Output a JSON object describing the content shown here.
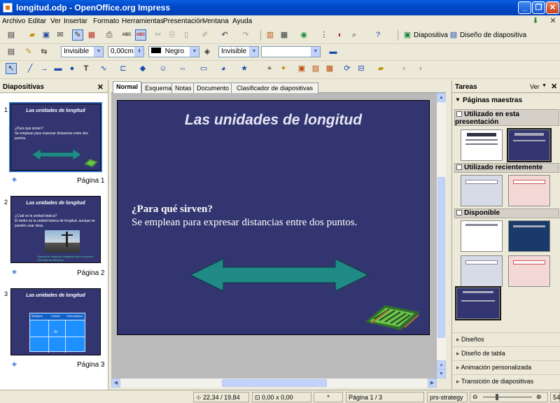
{
  "window": {
    "title": "longitud.odp - OpenOffice.org Impress",
    "buttons": [
      "_",
      "❐",
      "✕"
    ]
  },
  "menu": [
    "Archivo",
    "Editar",
    "Ver",
    "Insertar",
    "Formato",
    "Herramientas",
    "Presentación",
    "Ventana",
    "Ayuda"
  ],
  "toolbar1": {
    "diapositiva_label": "Diapositiva",
    "diseno_label": "Diseño de diapositiva"
  },
  "toolbar2": {
    "line_style": "Invisible",
    "line_width": "0,00cm",
    "line_color": "Negro",
    "area_style": "Invisible",
    "area_value": ""
  },
  "slides_panel": {
    "title": "Diapositivas",
    "slides": [
      {
        "num": "1",
        "title": "Las unidades de longitud",
        "text": "¿Para qué sirven?\nSe emplean para expresar distancias entre dos puntos.",
        "page": "Página 1"
      },
      {
        "num": "2",
        "title": "Las unidades de longitud",
        "text": "¿Cuál es la unidad básica?\nEl metro es la unidad básica de longitud, aunque se pueden usar otras.",
        "caption": "Barras de medición antiguas sobre la escala\nEscuela de Medición",
        "page": "Página 2"
      },
      {
        "num": "3",
        "title": "Las unidades de longitud",
        "table_headers": [
          "Múltiplos",
          "Unidad",
          "Submúltiplos"
        ],
        "table_center": "m",
        "page": "Página 3"
      }
    ]
  },
  "tabs": [
    {
      "label": "Normal",
      "active": true
    },
    {
      "label": "Esquema",
      "active": false
    },
    {
      "label": "Notas",
      "active": false
    },
    {
      "label": "Documento",
      "active": false
    },
    {
      "label": "Clasificador de diapositivas",
      "active": false
    }
  ],
  "slide": {
    "title": "Las unidades de longitud",
    "question": "¿Para qué sirven?",
    "answer": "Se emplean para expresar distancias entre dos puntos.",
    "arrow_color": "#1f8a86"
  },
  "tasks_panel": {
    "title": "Tareas",
    "view_label": "Ver",
    "master_pages": "Páginas maestras",
    "sections": [
      "Utilizado en esta presentación",
      "Utilizado recientemente",
      "Disponible"
    ],
    "links": [
      "Diseños",
      "Diseño de tabla",
      "Animación personalizada",
      "Transición de diapositivas"
    ]
  },
  "status": {
    "position": "22,34 / 19,84",
    "size": "0,00 x 0,00",
    "modified": "*",
    "page": "Página 1 / 3",
    "master": "prs-strategy",
    "zoom": "54"
  },
  "colors": {
    "title_bar": "#0a5fe0",
    "slide_bg": "#333570",
    "arrow": "#1f8a86",
    "selection": "#316ac5"
  }
}
